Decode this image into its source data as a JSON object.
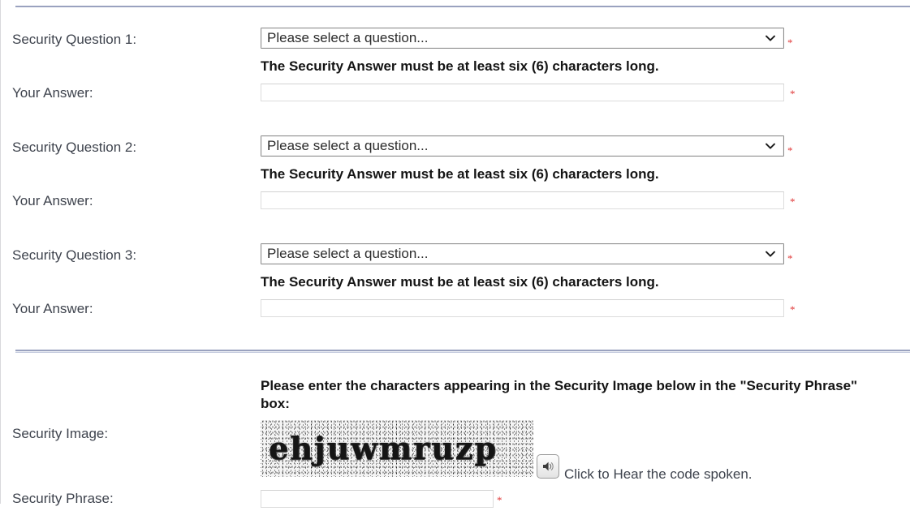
{
  "colors": {
    "divider": "#9aa2bf",
    "label_text": "#3e434d",
    "note_text": "#141414",
    "required_marker": "#e03a3a",
    "select_border": "#8c8c8c",
    "input_border": "#dcdcdc"
  },
  "security_questions": [
    {
      "label": "Security Question 1:",
      "select_value": "Please select a question...",
      "select_icon": "chevron-down-icon",
      "note": "The Security Answer must be at least six (6) characters long.",
      "answer_label": "Your Answer:",
      "answer_value": "",
      "answer_placeholder": "",
      "required_marker": "*"
    },
    {
      "label": "Security Question 2:",
      "select_value": "Please select a question...",
      "select_icon": "chevron-down-icon",
      "note": "The Security Answer must be at least six (6) characters long.",
      "answer_label": "Your Answer:",
      "answer_value": "",
      "answer_placeholder": "",
      "required_marker": "*"
    },
    {
      "label": "Security Question 3:",
      "select_value": "Please select a question...",
      "select_icon": "chevron-down-icon",
      "note": "The Security Answer must be at least six (6) characters long.",
      "answer_label": "Your Answer:",
      "answer_value": "",
      "answer_placeholder": "",
      "required_marker": "*"
    }
  ],
  "captcha_section": {
    "instruction": "Please enter the characters appearing in the Security Image below in the \"Security Phrase\" box:",
    "image_label": "Security Image:",
    "image_text": "ehjuwmruzp",
    "audio_button_icon": "speaker-icon",
    "audio_caption": "Click to Hear the code spoken.",
    "phrase_label": "Security Phrase:",
    "phrase_value": "",
    "phrase_placeholder": "",
    "required_marker": "*"
  }
}
